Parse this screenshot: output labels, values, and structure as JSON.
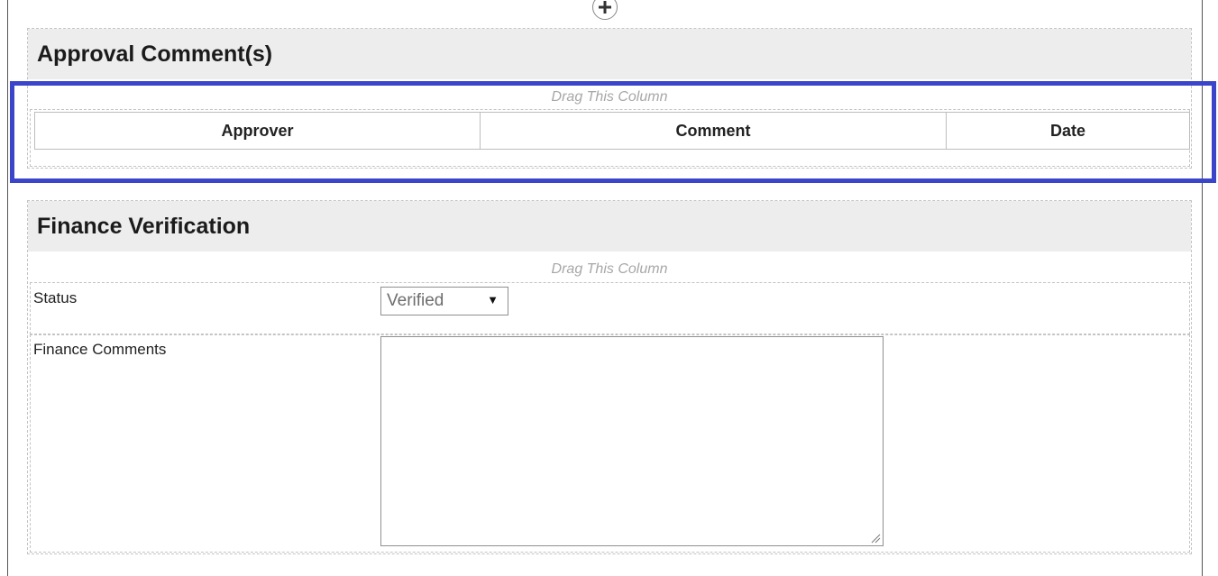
{
  "approval_section": {
    "title": "Approval Comment(s)",
    "drag_label": "Drag This Column",
    "columns": [
      "Approver",
      "Comment",
      "Date"
    ]
  },
  "finance_section": {
    "title": "Finance Verification",
    "drag_label": "Drag This Column",
    "status_label": "Status",
    "status_value": "Verified",
    "comments_label": "Finance Comments",
    "comments_value": ""
  },
  "icons": {
    "add": "plus-circle-icon",
    "dropdown": "triangle-down-icon",
    "resize": "resize-grip-icon"
  },
  "colors": {
    "highlight": "#3b45c9",
    "header_bg": "#ededed",
    "drag_text": "#a7a7a7"
  }
}
